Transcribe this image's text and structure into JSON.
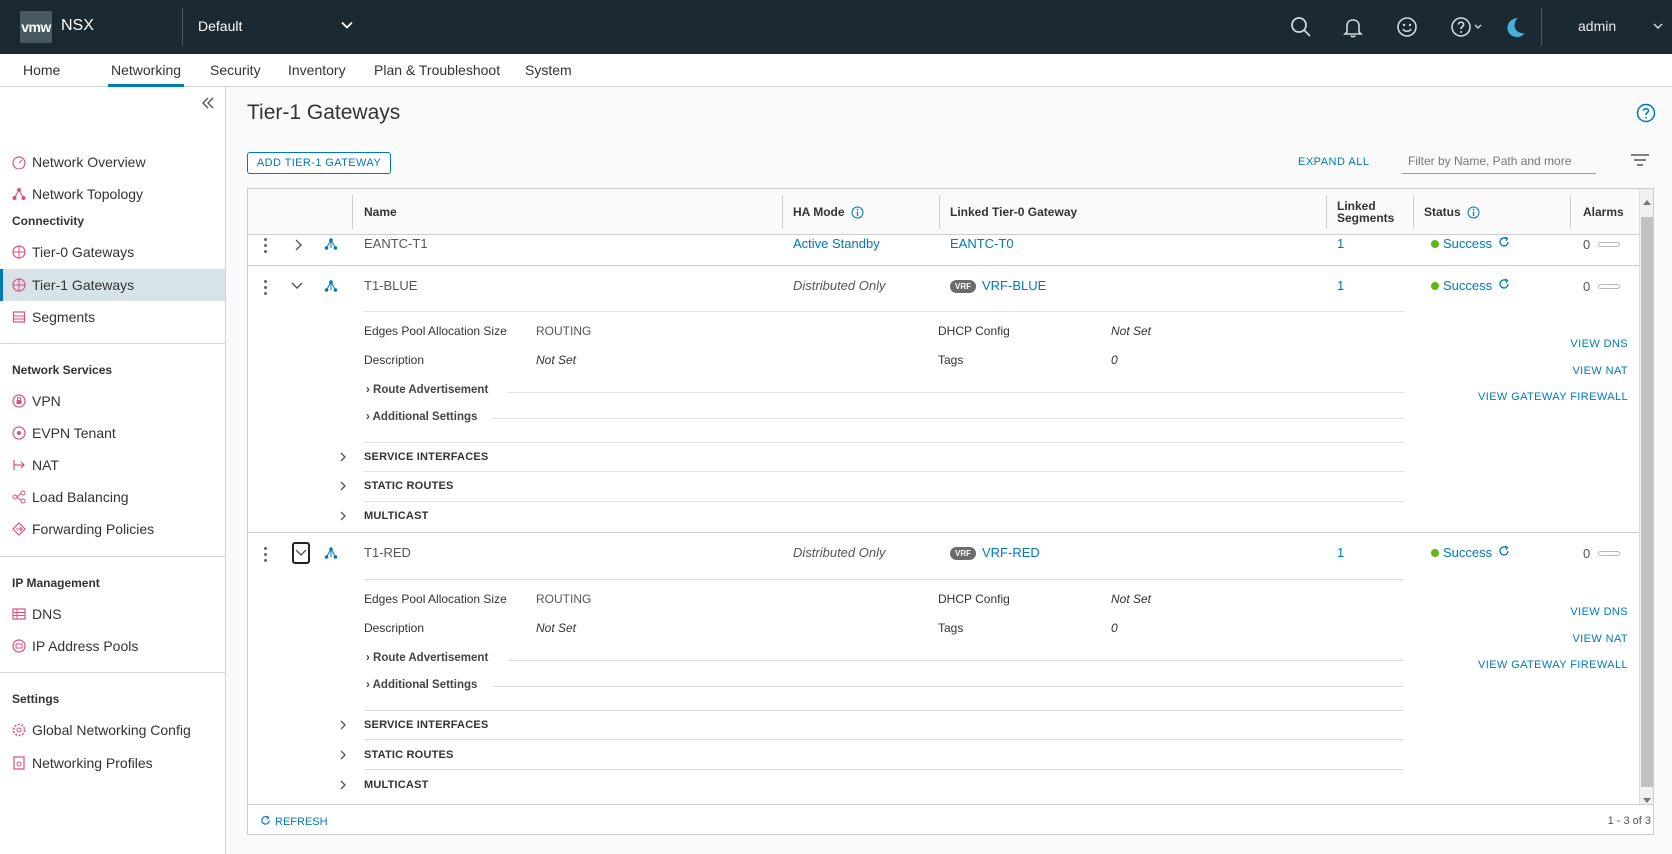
{
  "header": {
    "logo_text": "vmw",
    "app_name": "NSX",
    "project": "Default",
    "user": "admin"
  },
  "nav": {
    "tabs": [
      "Home",
      "Networking",
      "Security",
      "Inventory",
      "Plan & Troubleshoot",
      "System"
    ],
    "active": "Networking"
  },
  "sidebar": {
    "top_items": [
      "Network Overview",
      "Network Topology"
    ],
    "sections": [
      {
        "title": "Connectivity",
        "items": [
          "Tier-0 Gateways",
          "Tier-1 Gateways",
          "Segments"
        ]
      },
      {
        "title": "Network Services",
        "items": [
          "VPN",
          "EVPN Tenant",
          "NAT",
          "Load Balancing",
          "Forwarding Policies"
        ]
      },
      {
        "title": "IP Management",
        "items": [
          "DNS",
          "IP Address Pools"
        ]
      },
      {
        "title": "Settings",
        "items": [
          "Global Networking Config",
          "Networking Profiles"
        ]
      }
    ],
    "active_item": "Tier-1 Gateways"
  },
  "page": {
    "title": "Tier-1 Gateways",
    "add_button": "ADD TIER-1 GATEWAY",
    "expand_all": "EXPAND ALL",
    "filter_placeholder": "Filter by Name, Path and more"
  },
  "table": {
    "columns": {
      "name": "Name",
      "ha_mode": "HA Mode",
      "linked_t0": "Linked Tier-0 Gateway",
      "linked_segments_1": "Linked",
      "linked_segments_2": "Segments",
      "status": "Status",
      "alarms": "Alarms"
    },
    "rows": [
      {
        "name": "EANTC-T1",
        "ha_mode": "Active Standby",
        "linked_t0": "EANTC-T0",
        "vrf": false,
        "segments": "1",
        "status": "Success",
        "alarms": "0",
        "expanded": false
      },
      {
        "name": "T1-BLUE",
        "ha_mode": "Distributed Only",
        "linked_t0": "VRF-BLUE",
        "vrf": true,
        "vrf_badge": "VRF",
        "segments": "1",
        "status": "Success",
        "alarms": "0",
        "expanded": true
      },
      {
        "name": "T1-RED",
        "ha_mode": "Distributed Only",
        "linked_t0": "VRF-RED",
        "vrf": true,
        "vrf_badge": "VRF",
        "segments": "1",
        "status": "Success",
        "alarms": "0",
        "expanded": true
      }
    ],
    "details": {
      "edges_pool_label": "Edges Pool Allocation Size",
      "edges_pool_value": "ROUTING",
      "description_label": "Description",
      "description_value": "Not Set",
      "dhcp_label": "DHCP Config",
      "dhcp_value": "Not Set",
      "tags_label": "Tags",
      "tags_value": "0",
      "route_adv": "Route Advertisement",
      "additional": "Additional Settings",
      "view_dns": "VIEW DNS",
      "view_nat": "VIEW NAT",
      "view_fw": "VIEW GATEWAY FIREWALL",
      "service_interfaces": "SERVICE INTERFACES",
      "static_routes": "STATIC ROUTES",
      "multicast": "MULTICAST"
    },
    "footer": {
      "refresh": "REFRESH",
      "pager": "1 - 3 of 3"
    }
  },
  "colors": {
    "header_bg": "#1b2a32",
    "accent": "#0079b8",
    "success": "#5eb715",
    "icon_pink": "#d94f86"
  }
}
